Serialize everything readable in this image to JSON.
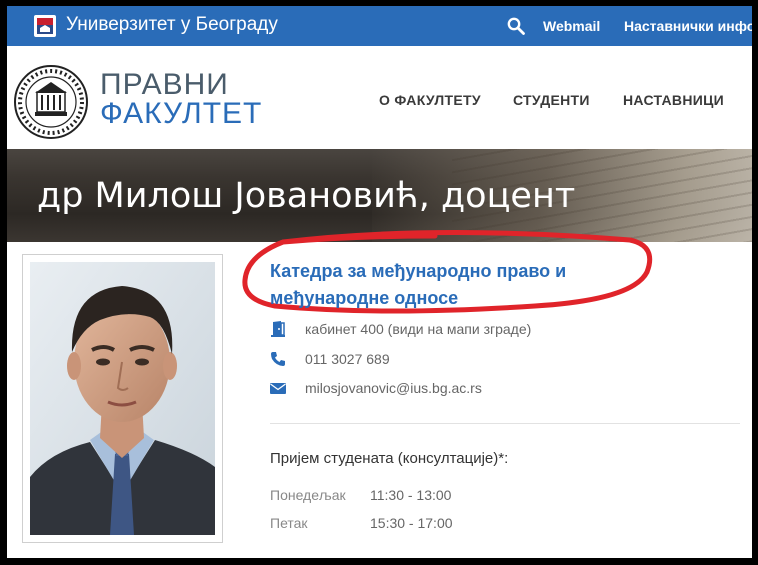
{
  "topbar": {
    "university": "Универзитет у Београду",
    "webmail": "Webmail",
    "teacher_info": "Наставнички инфо"
  },
  "header": {
    "faculty_line1": "ПРАВНИ",
    "faculty_line2": "ФАКУЛТЕТ",
    "nav": [
      "О ФАКУЛТЕТУ",
      "СТУДЕНТИ",
      "НАСТАВНИЦИ"
    ]
  },
  "banner": {
    "title": "др Милош Јовановић, доцент"
  },
  "profile": {
    "department": "Катедра за међународно право и међународне односе",
    "office": "кабинет 400 (види на мапи зграде)",
    "phone": "011 3027 689",
    "email": "milosjovanovic@ius.bg.ac.rs"
  },
  "consultations": {
    "title": "Пријем студената (консултације)*:",
    "rows": [
      {
        "day": "Понедељак",
        "time": "11:30 - 13:00"
      },
      {
        "day": "Петак",
        "time": "15:30 - 17:00"
      }
    ]
  },
  "colors": {
    "brand_blue": "#2a6cb8",
    "annotation_red": "#e0242a"
  },
  "icons": [
    "university-logo-icon",
    "search-icon",
    "door-icon",
    "phone-icon",
    "envelope-icon"
  ]
}
